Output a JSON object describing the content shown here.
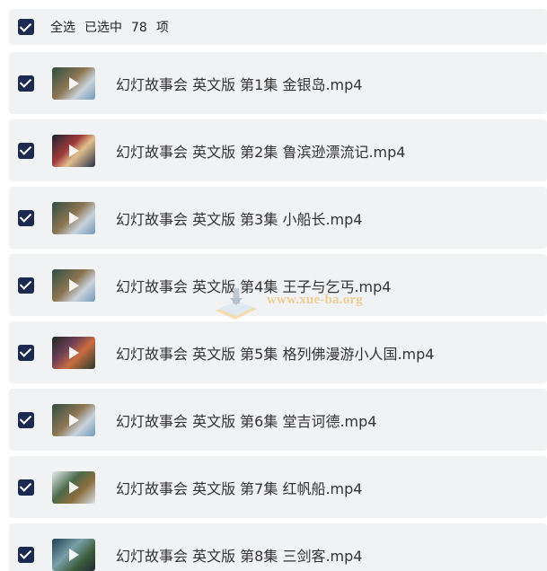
{
  "header": {
    "select_all_label": "全选",
    "selected_prefix": "已选中",
    "selected_count": "78",
    "selected_suffix": "项"
  },
  "files": [
    {
      "name": "幻灯故事会 英文版 第1集 金银岛.mp4",
      "thumb": "v1"
    },
    {
      "name": "幻灯故事会 英文版 第2集 鲁滨逊漂流记.mp4",
      "thumb": "v2"
    },
    {
      "name": "幻灯故事会 英文版 第3集 小船长.mp4",
      "thumb": "v1"
    },
    {
      "name": "幻灯故事会 英文版 第4集 王子与乞丐.mp4",
      "thumb": "v1"
    },
    {
      "name": "幻灯故事会 英文版 第5集 格列佛漫游小人国.mp4",
      "thumb": "v3"
    },
    {
      "name": "幻灯故事会 英文版 第6集 堂吉诃德.mp4",
      "thumb": "v1"
    },
    {
      "name": "幻灯故事会 英文版 第7集 红帆船.mp4",
      "thumb": "v4"
    },
    {
      "name": "幻灯故事会 英文版 第8集 三剑客.mp4",
      "thumb": "v5"
    }
  ],
  "watermark": {
    "text": "www.xue-ba.org"
  },
  "colors": {
    "checkbox": "#1b2a4e",
    "row_background": "#f1f2f4"
  }
}
